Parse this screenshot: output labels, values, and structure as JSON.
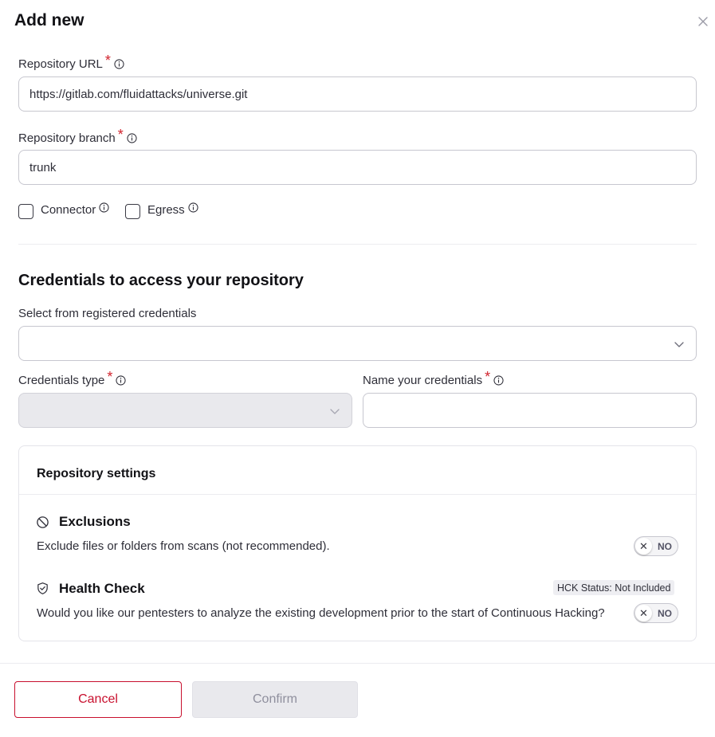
{
  "dialog": {
    "title": "Add new"
  },
  "repo_url": {
    "label": "Repository URL",
    "required": "*",
    "value": "https://gitlab.com/fluidattacks/universe.git"
  },
  "repo_branch": {
    "label": "Repository branch",
    "required": "*",
    "value": "trunk"
  },
  "options": {
    "connector_label": "Connector",
    "egress_label": "Egress"
  },
  "credentials": {
    "section_title": "Credentials to access your repository",
    "select_label": "Select from registered credentials",
    "select_value": "",
    "type_label": "Credentials type",
    "type_required": "*",
    "type_value": "",
    "name_label": "Name your credentials",
    "name_required": "*",
    "name_value": ""
  },
  "settings": {
    "title": "Repository settings",
    "exclusions": {
      "title": "Exclusions",
      "description": "Exclude files or folders from scans (not recommended).",
      "toggle_state": "NO",
      "icon": "block-icon"
    },
    "health_check": {
      "title": "Health Check",
      "description": "Would you like our pentesters to analyze the existing development prior to the start of Continuous Hacking?",
      "toggle_state": "NO",
      "badge": "HCK Status: Not Included",
      "icon": "shield-check-icon"
    }
  },
  "footer": {
    "cancel_label": "Cancel",
    "confirm_label": "Confirm"
  },
  "colors": {
    "accent": "#c8102e",
    "required": "#d1232d",
    "disabled_bg": "#e9e9ed"
  }
}
